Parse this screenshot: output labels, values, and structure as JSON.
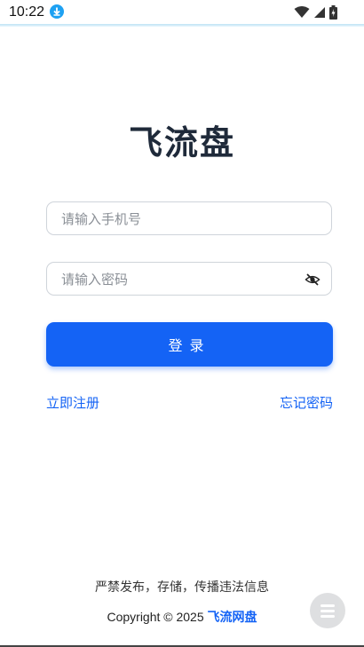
{
  "status_bar": {
    "time": "10:22",
    "icons": [
      "download-icon",
      "wifi-icon",
      "signal-icon",
      "battery-icon"
    ]
  },
  "app": {
    "title": "飞流盘"
  },
  "form": {
    "phone_placeholder": "请输入手机号",
    "phone_value": "",
    "password_placeholder": "请输入密码",
    "password_value": "",
    "password_toggle_icon": "eye-off-icon",
    "login_label": "登录"
  },
  "links": {
    "register": "立即注册",
    "forgot_password": "忘记密码"
  },
  "footer": {
    "notice": "严禁发布，存储，传播违法信息",
    "copyright_prefix": "Copyright © 2025",
    "brand": "飞流网盘"
  },
  "colors": {
    "accent": "#1463f5",
    "title": "#1f2a3a"
  }
}
